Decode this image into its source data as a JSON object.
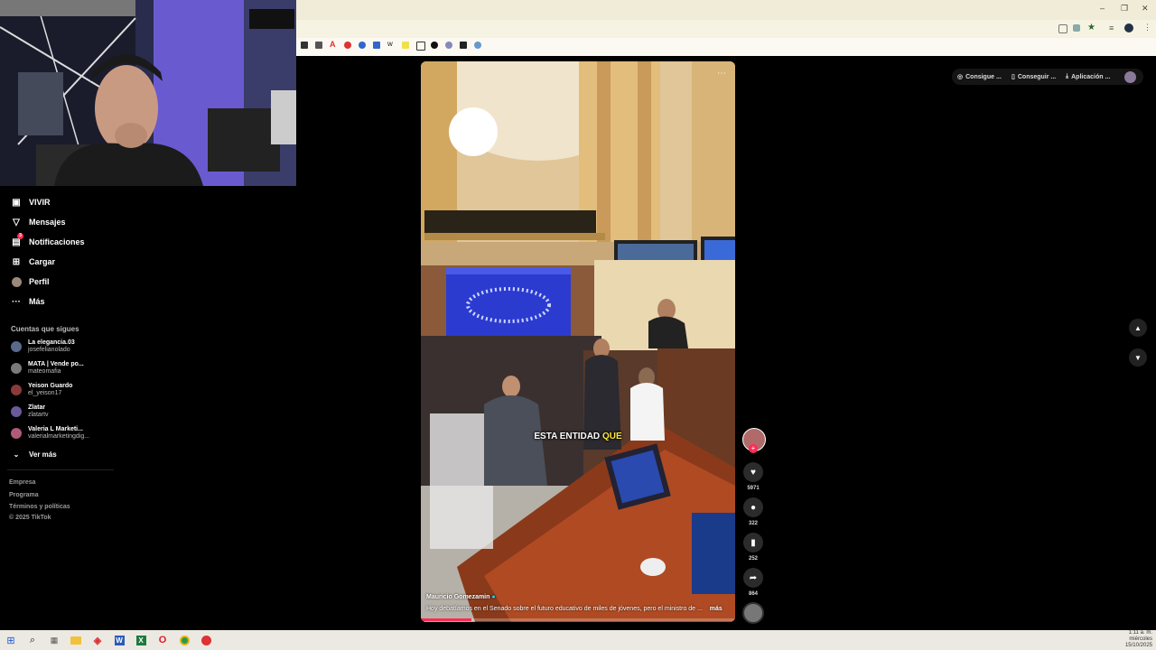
{
  "window": {
    "minimize_label": "–",
    "restore_label": "❐",
    "close_label": "✕"
  },
  "webcam": {
    "description_icon": "person-icon"
  },
  "sidebar": {
    "items": [
      {
        "label": "VIVIR",
        "icon": "live-icon"
      },
      {
        "label": "Mensajes",
        "icon": "send-icon"
      },
      {
        "label": "Notificaciones",
        "icon": "inbox-icon",
        "badge": "3"
      },
      {
        "label": "Cargar",
        "icon": "upload-icon"
      },
      {
        "label": "Perfil",
        "icon": "avatar-icon"
      },
      {
        "label": "Más",
        "icon": "more-icon"
      }
    ],
    "following_title": "Cuentas que sigues",
    "accounts": [
      {
        "name": "La elegancia.03",
        "handle": "josefelianolado",
        "color": "#5a6a8a"
      },
      {
        "name": "MATA | Vende po...",
        "handle": "mateomafia",
        "color": "#7a7a7a"
      },
      {
        "name": "Yeison Guardo",
        "handle": "el_yeison17",
        "color": "#8a3a3a"
      },
      {
        "name": "Zlatar",
        "handle": "zlatartv",
        "color": "#6a5a9a"
      },
      {
        "name": "Valeria L Marketi...",
        "handle": "valerialmarketingdig...",
        "color": "#b05a7a"
      }
    ],
    "see_more": "Ver más",
    "footer": [
      "Empresa",
      "Programa",
      "Términos y políticas",
      "© 2025 TikTok"
    ]
  },
  "header_actions": [
    {
      "label": "Consigue ...",
      "icon": "coin-icon"
    },
    {
      "label": "Conseguir ...",
      "icon": "phone-icon"
    },
    {
      "label": "Aplicación ...",
      "icon": "download-icon"
    }
  ],
  "video": {
    "caption": "ESTA ENTIDAD QUE",
    "caption_white": "ESTA ENTIDAD",
    "caption_yellow": "QUE",
    "author": "Mauricio Gomezamin",
    "description": "Hoy debatíamos en el Senado sobre el futuro educativo de miles de jóvenes, pero el ministro de ...",
    "more": "más",
    "progress": 0.16
  },
  "actions": {
    "likes": "5971",
    "comments": "322",
    "saves": "252",
    "shares": "864"
  },
  "nav": {
    "up": "▲",
    "down": "▼"
  },
  "taskbar": {
    "time": "1:11 a. m.",
    "day": "miércoles",
    "date": "15/10/2025"
  }
}
